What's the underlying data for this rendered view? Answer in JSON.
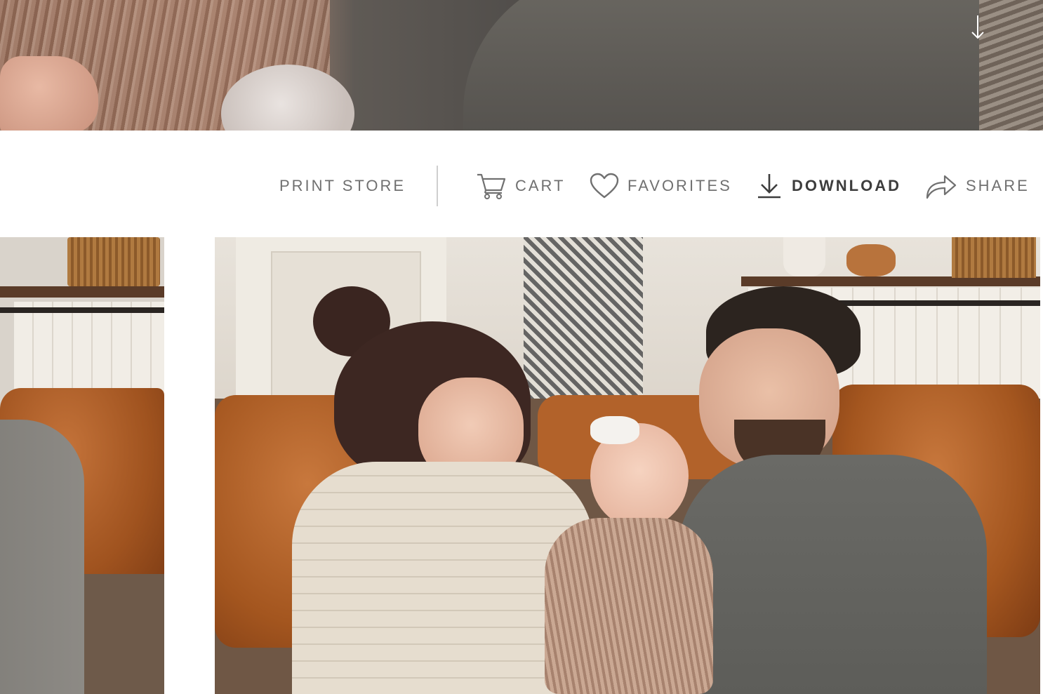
{
  "colors": {
    "toolbar_text": "#707070",
    "toolbar_text_active": "#3d3d3d",
    "divider": "#cfcfcf",
    "background": "#ffffff"
  },
  "hero": {
    "scroll_icon": "arrow-down-icon"
  },
  "toolbar": {
    "print_store_label": "PRINT STORE",
    "cart": {
      "label": "CART",
      "icon": "cart-icon"
    },
    "favorites": {
      "label": "FAVORITES",
      "icon": "heart-icon"
    },
    "download": {
      "label": "DOWNLOAD",
      "icon": "download-icon",
      "active": true
    },
    "share": {
      "label": "SHARE",
      "icon": "share-icon"
    }
  },
  "gallery": {
    "photos": [
      "family-photo-left-partial",
      "family-photo-main"
    ]
  }
}
